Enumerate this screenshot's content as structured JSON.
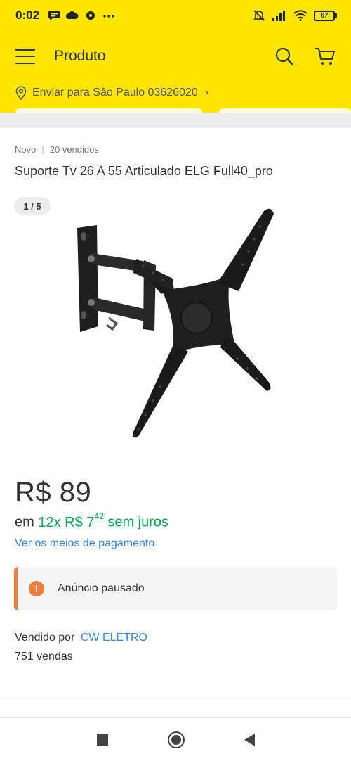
{
  "status_bar": {
    "time": "0:02",
    "battery": "67",
    "icons": [
      "message-icon",
      "cloud-icon",
      "soccer-ball-icon",
      "more-dots-icon",
      "mute-alarm-icon",
      "signal-icon",
      "wifi-icon",
      "battery-icon"
    ]
  },
  "header": {
    "title": "Produto",
    "location": "Enviar para São Paulo 03626020",
    "icons": [
      "menu-icon",
      "search-icon",
      "cart-icon",
      "location-pin-icon",
      "chevron-right-icon"
    ],
    "bg_color": "#ffe600"
  },
  "product": {
    "condition": "Novo",
    "sold": "20 vendidos",
    "title": "Suporte Tv 26 A 55 Articulado ELG Full40_pro",
    "image_counter": "1 / 5",
    "image_alt": "TV wall mount"
  },
  "price": {
    "main": "R$ 89",
    "installments_prefix": "em",
    "installments_count": "12x R$ 7",
    "installments_cents": "42",
    "installments_suffix": "sem juros",
    "payment_link": "Ver os meios de pagamento",
    "accent_green": "#00a650",
    "link_blue": "#3483fa"
  },
  "notice": {
    "icon": "alert-icon",
    "text": "Anúncio pausado",
    "color": "#f07e3d"
  },
  "seller": {
    "label": "Vendido por",
    "name": "CW ELETRO",
    "sales": "751 vendas"
  },
  "nav_bar": {
    "icons": [
      "recent-apps-icon",
      "home-icon",
      "back-icon"
    ]
  }
}
